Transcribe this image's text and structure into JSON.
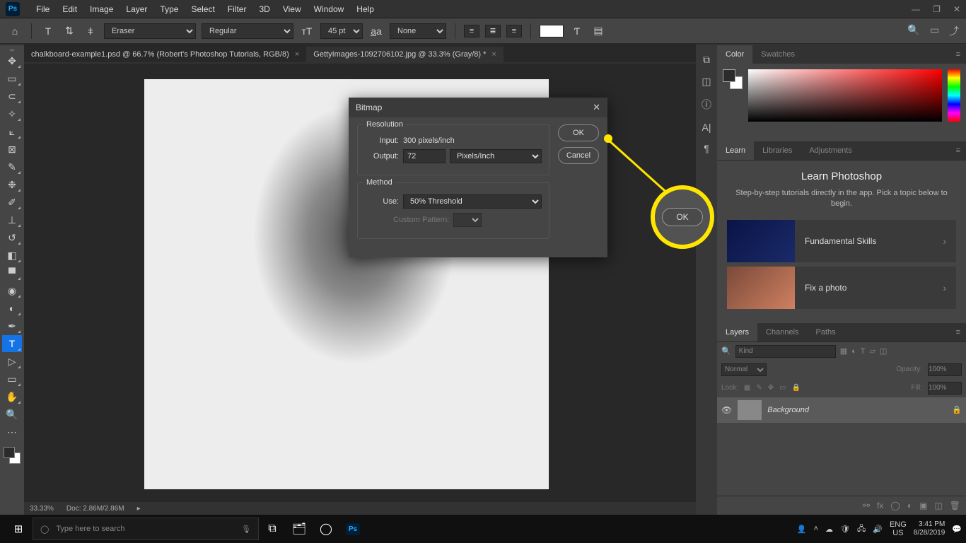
{
  "menu": [
    "File",
    "Edit",
    "Image",
    "Layer",
    "Type",
    "Select",
    "Filter",
    "3D",
    "View",
    "Window",
    "Help"
  ],
  "optbar": {
    "preset": "Eraser",
    "style": "Regular",
    "size": "45 pt",
    "antialias": "None"
  },
  "tabs": [
    {
      "label": "chalkboard-example1.psd @ 66.7% (Robert's Photoshop Tutorials, RGB/8)",
      "active": false
    },
    {
      "label": "GettyImages-1092706102.jpg @ 33.3% (Gray/8) *",
      "active": true
    }
  ],
  "status": {
    "zoom": "33.33%",
    "doc": "Doc: 2.86M/2.86M"
  },
  "dialog": {
    "title": "Bitmap",
    "resolution_legend": "Resolution",
    "input_label": "Input:",
    "input_value": "300 pixels/inch",
    "output_label": "Output:",
    "output_value": "72",
    "output_unit": "Pixels/Inch",
    "method_legend": "Method",
    "use_label": "Use:",
    "use_value": "50% Threshold",
    "custom_label": "Custom Pattern:",
    "ok": "OK",
    "cancel": "Cancel"
  },
  "callout_ok": "OK",
  "panels": {
    "color_tabs": [
      "Color",
      "Swatches"
    ],
    "learn_tabs": [
      "Learn",
      "Libraries",
      "Adjustments"
    ],
    "learn_title": "Learn Photoshop",
    "learn_desc": "Step-by-step tutorials directly in the app. Pick a topic below to begin.",
    "lessons": [
      "Fundamental Skills",
      "Fix a photo"
    ],
    "layer_tabs": [
      "Layers",
      "Channels",
      "Paths"
    ],
    "layer_filter": "Kind",
    "blend": "Normal",
    "opacity_label": "Opacity:",
    "opacity": "100%",
    "lock_label": "Lock:",
    "fill_label": "Fill:",
    "fill": "100%",
    "layer_name": "Background"
  },
  "taskbar": {
    "search_placeholder": "Type here to search",
    "lang": "ENG",
    "region": "US",
    "time": "3:41 PM",
    "date": "8/28/2019"
  }
}
